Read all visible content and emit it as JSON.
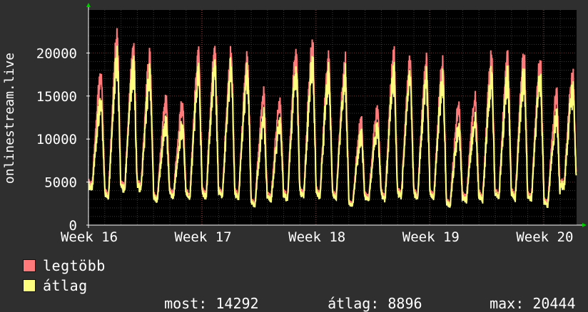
{
  "colors": {
    "background": "#2f2f2f",
    "plot_background": "#000000",
    "grid_major": "#6b2b2b",
    "grid_minor": "#3a3a3a",
    "axis": "#ffffff",
    "arrow": "#00cc00",
    "max_series": "#ff7b7b",
    "avg_series": "#ffff7f"
  },
  "chart_data": {
    "type": "line",
    "ylabel": "onlinestream.live",
    "ylim": [
      0,
      25000
    ],
    "yticks": [
      0,
      5000,
      10000,
      15000,
      20000
    ],
    "ytick_labels": [
      "0",
      "5000",
      "10000",
      "15000",
      "20000"
    ],
    "xticks": [
      "Week 16",
      "Week 17",
      "Week 18",
      "Week 19",
      "Week 20"
    ],
    "grid": true,
    "legend_position": "bottom",
    "days": 30,
    "series": [
      {
        "name": "legtöbb",
        "daily_peak": [
          18000,
          22500,
          21000,
          20000,
          15000,
          14500,
          20500,
          20800,
          20500,
          20000,
          15500,
          14800,
          21000,
          21500,
          20000,
          19500,
          12500,
          14000,
          20000,
          19800,
          19500,
          19200,
          14500,
          15000,
          20000,
          19900,
          20100,
          19700,
          15500,
          18000
        ],
        "daily_low": [
          4800,
          3500,
          4500,
          4600,
          3200,
          3800,
          3400,
          3600,
          3700,
          3500,
          2500,
          3300,
          3300,
          3700,
          3600,
          3400,
          2500,
          3300,
          3300,
          3600,
          3500,
          3400,
          2500,
          3300,
          3200,
          3500,
          3400,
          3300,
          2500,
          4800
        ]
      },
      {
        "name": "átlag",
        "daily_peak": [
          15000,
          20300,
          19500,
          18000,
          12500,
          12000,
          18500,
          19200,
          19000,
          18500,
          13000,
          12500,
          19000,
          19500,
          18500,
          18000,
          11000,
          12000,
          18000,
          18000,
          17800,
          17500,
          12000,
          12500,
          18000,
          18000,
          18200,
          18000,
          13000,
          16500
        ],
        "daily_low": [
          4500,
          3200,
          4200,
          4300,
          3000,
          3500,
          3100,
          3300,
          3400,
          3200,
          2300,
          3000,
          3000,
          3400,
          3300,
          3100,
          2300,
          3000,
          3000,
          3300,
          3200,
          3100,
          2300,
          3000,
          2900,
          3200,
          3100,
          3000,
          2300,
          4500
        ]
      }
    ]
  },
  "legend": {
    "max_label": "legtöbb",
    "avg_label": "átlag"
  },
  "stats": {
    "current_label": "most:",
    "current_value": "14292",
    "avg_label": "átlag:",
    "avg_value": "8896",
    "max_label": "max:",
    "max_value": "20444"
  }
}
